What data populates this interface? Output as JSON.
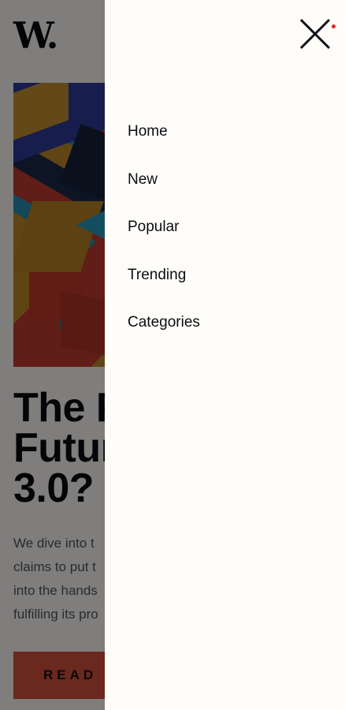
{
  "site": {
    "logo_text": "W."
  },
  "article": {
    "title_line1": "The F",
    "title_line2": "Futur",
    "title_line3": "3.0?",
    "excerpt_line1": "We dive into t",
    "excerpt_line2": "claims to put t",
    "excerpt_line3": "into the hands",
    "excerpt_line4": "fulfilling its pro",
    "cta_label": "READ M"
  },
  "drawer": {
    "menu": [
      {
        "label": "Home"
      },
      {
        "label": "New"
      },
      {
        "label": "Popular"
      },
      {
        "label": "Trending"
      },
      {
        "label": "Categories"
      }
    ],
    "close_icon": "close-icon",
    "notification_dot_color": "#e0262c"
  },
  "colors": {
    "background": "#fffdf9",
    "text": "#0b0b12",
    "accent": "#d4503f",
    "overlay": "rgba(0,0,0,0.5)"
  }
}
